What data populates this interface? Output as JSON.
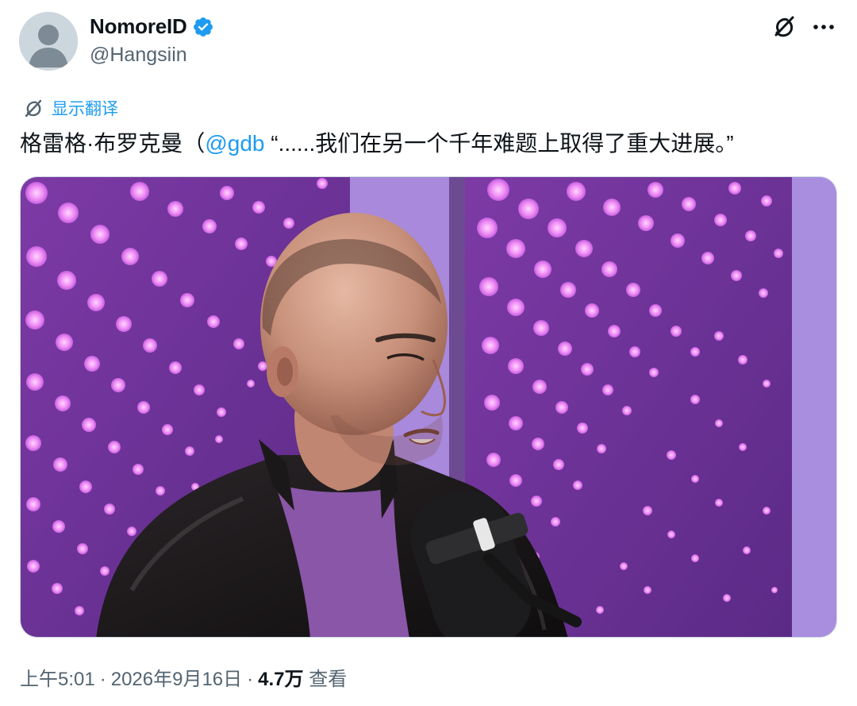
{
  "author": {
    "display_name": "NomoreID",
    "handle": "@Hangsiin",
    "verified": true
  },
  "header_icons": {
    "grok": "grok-icon",
    "more": "more-icon"
  },
  "translate": {
    "label": "显示翻译",
    "icon": "translate-icon"
  },
  "tweet": {
    "text_before": "格雷格·布罗克曼（",
    "mention": "@gdb",
    "text_after": "“......我们在另一个千年难题上取得了重大进展。”"
  },
  "media": {
    "type": "photo"
  },
  "meta": {
    "time": "上午5:01",
    "separator": "·",
    "date": "2026年9月16日",
    "views_count": "4.7万",
    "views_label": "查看"
  },
  "colors": {
    "accent": "#1d9bf0",
    "text_primary": "#0f1419",
    "text_secondary": "#536471",
    "backdrop_purple": "#7a3fa0",
    "backdrop_light": "#b89be8"
  }
}
